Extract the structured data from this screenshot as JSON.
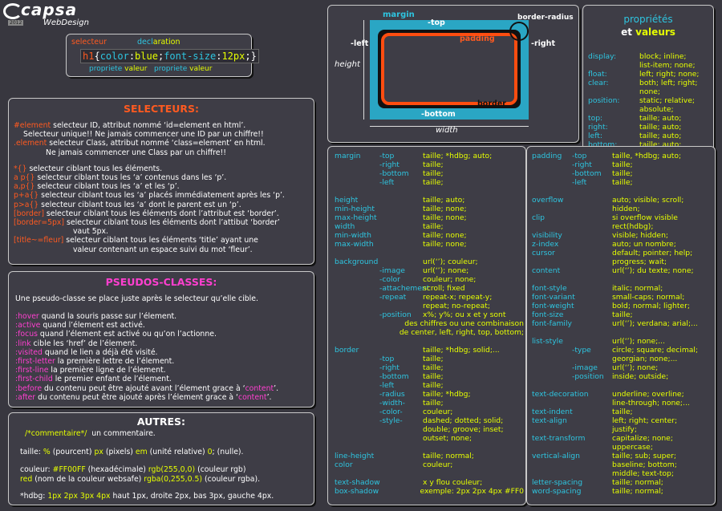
{
  "logo": {
    "name": "capsa",
    "sub": "WebDesign",
    "badge": "2012"
  },
  "syntax": {
    "selecteur_label": "selecteur",
    "declaration_label": "declaration",
    "sel": "h1",
    "open": "{",
    "p1": "color",
    "c1": ":",
    "v1": "blue",
    "s1": ";",
    "p2": "font-size",
    "c2": ":",
    "v2": "12px",
    "s2": ";",
    "close": "}",
    "prop1": "propriete",
    "val1": "valeur",
    "prop2": "propriete",
    "val2": "valeur"
  },
  "selecteurs": {
    "title": "SELECTEURS:",
    "lines": [
      {
        "code": "#element",
        "text": " selecteur ID, attribut nommé ‘id=element en html’."
      },
      {
        "code": "",
        "text": "Selecteur unique!! Ne jamais commencer une ID par un chiffre!!"
      },
      {
        "code": ".element",
        "text": " selecteur Class, attribut nommé ‘class=element’ en html."
      },
      {
        "code": "",
        "text": "Ne jamais commencer une Class par un chiffre!!"
      },
      {
        "code": "*{}",
        "text": " selecteur ciblant tous les éléments."
      },
      {
        "code": "a p{}",
        "text": " selecteur ciblant tous les ‘a’ contenus dans les ‘p’."
      },
      {
        "code": "a,p{}",
        "text": " selecteur ciblant tous les ‘a’ et les ‘p’."
      },
      {
        "code": "p+a{}",
        "text": " selecteur ciblant tous les ‘a’ placés immédiatement après les ‘p’."
      },
      {
        "code": "p>a{}",
        "text": " selecteur ciblant tous les ‘a’ dont le parent est un ‘p’."
      },
      {
        "code": "[border]",
        "text": " selecteur ciblant tous les éléments dont l’attribut est ‘border’."
      },
      {
        "code": "[border=5px]",
        "text": " selecteur ciblant tous les éléments dont l’attibut ‘border’"
      },
      {
        "code": "",
        "text": "vaut 5px."
      },
      {
        "code": "[title~=fleur]",
        "text": " selecteur ciblant tous les éléments ‘title’ ayant une"
      },
      {
        "code": "",
        "text": "valeur contenant un espace suivi du mot ‘fleur’."
      }
    ]
  },
  "pseudos": {
    "title": "PSEUDOS-CLASSES:",
    "intro": "Une pseudo-classe se place juste après le selecteur qu’elle cible.",
    "lines": [
      {
        "code": ":hover",
        "text": " quand la souris passe sur l’élement."
      },
      {
        "code": ":active",
        "text": " quand l’élement est activé."
      },
      {
        "code": ":focus",
        "text": " quand l’élement est activé ou qu’on l’actionne."
      },
      {
        "code": ":link",
        "text": " cible les ‘href’ de l’élement."
      },
      {
        "code": ":visited",
        "text": " quand le lien a déjà été visité."
      },
      {
        "code": ":first-letter",
        "text": " la première lettre de l’élement."
      },
      {
        "code": ":first-line",
        "text": " la première ligne de l’élement."
      },
      {
        "code": ":first-child",
        "text": " le premier enfant de l’élement."
      },
      {
        "code": ":before",
        "text": " du contenu peut être ajouté avant l’élement grace à ‘",
        "tail": "content",
        "end": "’."
      },
      {
        "code": ":after",
        "text": " du contenu peut être ajouté après l’élement grace à ‘",
        "tail": "content",
        "end": "’."
      }
    ]
  },
  "autres": {
    "title": "AUTRES:",
    "comment_code": "/*commentaire*/",
    "comment_text": "un commentaire.",
    "taille_label": "taille:",
    "taille_pct": "%",
    "taille_pct_t": "(pourcent)",
    "taille_px": "px",
    "taille_px_t": "(pixels)",
    "taille_em": "em",
    "taille_em_t": "(unité relative)",
    "taille_zero": "0",
    "taille_zero_t": "; (nulle).",
    "couleur_label": "couleur:",
    "couleur_hex": "#FF00FF",
    "couleur_hex_t": "(hexadécimale)",
    "couleur_rgb": "rgb(255,0,0)",
    "couleur_rgb_t": "(couleur rgb)",
    "couleur_red": "red",
    "couleur_red_t": "(nom de la couleur websafe)",
    "couleur_rgba": "rgba(0,255,0.5)",
    "couleur_rgba_t": "(couleur rgba).",
    "hdbg_label": "*hdbg:",
    "hdbg_code": "1px 2px 3px 4px",
    "hdbg_text": "haut 1px, droite 2px, bas 3px, gauche 4px."
  },
  "boxmodel": {
    "margin": "margin",
    "top": "-top",
    "left": "-left",
    "right": "-right",
    "bottom": "-bottom",
    "padding": "padding",
    "border": "border",
    "radius": "border-radius",
    "height": "height",
    "width": "width"
  },
  "props_title": {
    "line1": "propriétés",
    "et": "et",
    "valeurs": "valeurs"
  },
  "props_top": [
    {
      "k": "display:",
      "v": "block; inline;"
    },
    {
      "k": "",
      "v": "list-item; none;"
    },
    {
      "k": "float:",
      "v": "left; right; none;"
    },
    {
      "k": "clear:",
      "v": "both; left; right;"
    },
    {
      "k": "",
      "v": "none;"
    },
    {
      "k": "position:",
      "v": "static; relative;"
    },
    {
      "k": "",
      "v": "absolute;"
    },
    {
      "k": "top:",
      "v": "taille; auto;"
    },
    {
      "k": "right:",
      "v": "taille; auto;"
    },
    {
      "k": "left:",
      "v": "taille; auto;"
    },
    {
      "k": "bottom:",
      "v": "taille; auto;"
    }
  ],
  "mid_rows": [
    {
      "k": "margin",
      "s": "-top",
      "v": "taille; *hdbg; auto;"
    },
    {
      "k": "",
      "s": "-right",
      "v": "taille;"
    },
    {
      "k": "",
      "s": "-bottom",
      "v": "taille;"
    },
    {
      "k": "",
      "s": "-left",
      "v": "taille;"
    },
    {
      "k": "",
      "s": "",
      "v": ""
    },
    {
      "k": "height",
      "s": "",
      "v": "taille; auto;"
    },
    {
      "k": "min-height",
      "s": "",
      "v": "taille; none;"
    },
    {
      "k": "max-height",
      "s": "",
      "v": "taille; none;"
    },
    {
      "k": "width",
      "s": "",
      "v": "taille;"
    },
    {
      "k": "min-width",
      "s": "",
      "v": "taille; none;"
    },
    {
      "k": "max-width",
      "s": "",
      "v": "taille; none;"
    },
    {
      "k": "",
      "s": "",
      "v": ""
    },
    {
      "k": "background",
      "s": "",
      "v": "url(‘’); couleur;"
    },
    {
      "k": "",
      "s": "-image",
      "v": "url(‘’); none;"
    },
    {
      "k": "",
      "s": "-color",
      "v": "couleur; none;"
    },
    {
      "k": "",
      "s": "-attachement",
      "v": "scroll; fixed"
    },
    {
      "k": "",
      "s": "-repeat",
      "v": "repeat-x; repeat-y;"
    },
    {
      "k": "",
      "s": "",
      "v": "repeat; no-repeat;"
    },
    {
      "k": "",
      "s": "-position",
      "v": "x%; y%; ou x et y sont"
    },
    {
      "k": "",
      "s": "",
      "v": "des chiffres ou une combinaison"
    },
    {
      "k": "",
      "s": "",
      "v": "de center, left, right, top, bottom;"
    },
    {
      "k": "",
      "s": "",
      "v": ""
    },
    {
      "k": "border",
      "s": "",
      "v": "taille; *hdbg; solid;..."
    },
    {
      "k": "",
      "s": "-top",
      "v": "taille;"
    },
    {
      "k": "",
      "s": "-right",
      "v": "taille;"
    },
    {
      "k": "",
      "s": "-bottom",
      "v": "taille;"
    },
    {
      "k": "",
      "s": "-left",
      "v": "taille;"
    },
    {
      "k": "",
      "s": "-radius",
      "v": "taille; *hdbg;"
    },
    {
      "k": "",
      "s": "-width-",
      "v": "taille;"
    },
    {
      "k": "",
      "s": "-color-",
      "v": "couleur;"
    },
    {
      "k": "",
      "s": "-style-",
      "v": "dashed; dotted; solid;"
    },
    {
      "k": "",
      "s": "",
      "v": "double; groove; inset;"
    },
    {
      "k": "",
      "s": "",
      "v": "outset; none;"
    },
    {
      "k": "",
      "s": "",
      "v": ""
    },
    {
      "k": "line-height",
      "s": "",
      "v": "taille; normal;"
    },
    {
      "k": "color",
      "s": "",
      "v": "couleur;"
    },
    {
      "k": "",
      "s": "",
      "v": ""
    },
    {
      "k": "text-shadow",
      "s": "",
      "v": "x y flou couleur;"
    },
    {
      "k": "box-shadow",
      "s": "",
      "v": "exemple: 2px 2px 4px #FF0"
    }
  ],
  "right_rows": [
    {
      "k": "padding",
      "s": "-top",
      "v": "taille, *hdbg; auto;"
    },
    {
      "k": "",
      "s": "-right",
      "v": "taille;"
    },
    {
      "k": "",
      "s": "-bottom",
      "v": "taille;"
    },
    {
      "k": "",
      "s": "-left",
      "v": "taille;"
    },
    {
      "k": "",
      "s": "",
      "v": ""
    },
    {
      "k": "overflow",
      "s": "",
      "v": "auto; visible; scroll;"
    },
    {
      "k": "",
      "s": "",
      "v": "hidden;"
    },
    {
      "k": "clip",
      "s": "",
      "v": "si overflow visible"
    },
    {
      "k": "",
      "s": "",
      "v": "rect(hdbg);"
    },
    {
      "k": "visibility",
      "s": "",
      "v": "visible; hidden;"
    },
    {
      "k": "z-index",
      "s": "",
      "v": "auto; un nombre;"
    },
    {
      "k": "cursor",
      "s": "",
      "v": "default; pointer; help;"
    },
    {
      "k": "",
      "s": "",
      "v": "progress; wait;"
    },
    {
      "k": "content",
      "s": "",
      "v": "url(‘’); du texte; none;"
    },
    {
      "k": "",
      "s": "",
      "v": ""
    },
    {
      "k": "font-style",
      "s": "",
      "v": "italic; normal;"
    },
    {
      "k": "font-variant",
      "s": "",
      "v": "small-caps; normal;"
    },
    {
      "k": "font-weight",
      "s": "",
      "v": "bold; normal; lighter;"
    },
    {
      "k": "font-size",
      "s": "",
      "v": "taille;"
    },
    {
      "k": "font-family",
      "s": "",
      "v": "url(‘’); verdana; arial;..."
    },
    {
      "k": "",
      "s": "",
      "v": ""
    },
    {
      "k": "list-style",
      "s": "",
      "v": "url(‘’); none;..."
    },
    {
      "k": "",
      "s": "-type",
      "v": "circle; square; decimal;"
    },
    {
      "k": "",
      "s": "",
      "v": "georgian; none;..."
    },
    {
      "k": "",
      "s": "-image",
      "v": "url(‘’); none;"
    },
    {
      "k": "",
      "s": "-position",
      "v": "inside; outside;"
    },
    {
      "k": "",
      "s": "",
      "v": ""
    },
    {
      "k": "text-decoration",
      "s": "",
      "v": "underline; overline;"
    },
    {
      "k": "",
      "s": "",
      "v": "line-through; none;..."
    },
    {
      "k": "text-indent",
      "s": "",
      "v": "taille;"
    },
    {
      "k": "text-align",
      "s": "",
      "v": "left; right; center;"
    },
    {
      "k": "",
      "s": "",
      "v": "justify;"
    },
    {
      "k": "text-transform",
      "s": "",
      "v": "capitalize; none;"
    },
    {
      "k": "",
      "s": "",
      "v": "uppercase;"
    },
    {
      "k": "vertical-align",
      "s": "",
      "v": "taille; sub; super;"
    },
    {
      "k": "",
      "s": "",
      "v": "baseline; bottom;"
    },
    {
      "k": "",
      "s": "",
      "v": "middle; text-top;"
    },
    {
      "k": "letter-spacing",
      "s": "",
      "v": "taille; normal;"
    },
    {
      "k": "word-spacing",
      "s": "",
      "v": "taille; normal;"
    }
  ]
}
